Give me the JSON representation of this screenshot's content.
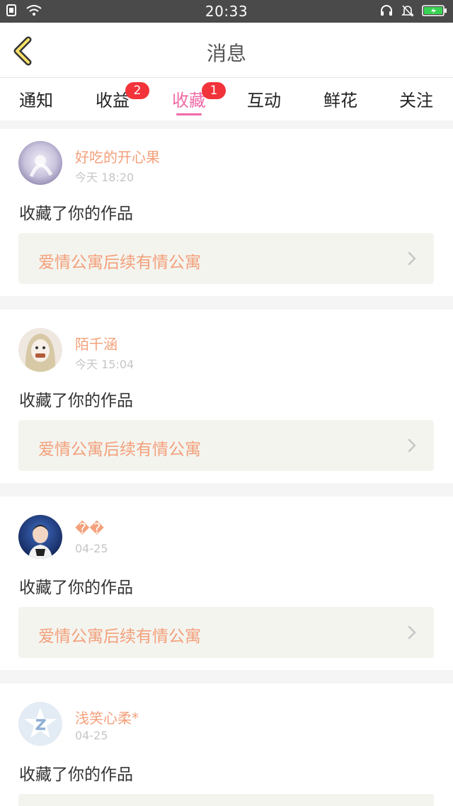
{
  "status_bar": {
    "time": "20:33"
  },
  "header": {
    "title": "消息"
  },
  "tabs": [
    {
      "label": "通知",
      "badge": ""
    },
    {
      "label": "收益",
      "badge": "2"
    },
    {
      "label": "收藏",
      "badge": "1"
    },
    {
      "label": "互动",
      "badge": ""
    },
    {
      "label": "鲜花",
      "badge": ""
    },
    {
      "label": "关注",
      "badge": ""
    }
  ],
  "active_tab": "收藏",
  "colors": {
    "accent": "#f06aa6",
    "name": "#f3a07b",
    "badge": "#f2333a"
  },
  "messages": [
    {
      "user": "好吃的开心果",
      "time": "今天 18:20",
      "action": "收藏了你的作品",
      "work": "爱情公寓后续有情公寓"
    },
    {
      "user": "陌千涵",
      "time": "今天 15:04",
      "action": "收藏了你的作品",
      "work": "爱情公寓后续有情公寓"
    },
    {
      "user": "��",
      "time": "04-25",
      "action": "收藏了你的作品",
      "work": "爱情公寓后续有情公寓"
    },
    {
      "user": "浅笑心柔*",
      "time": "04-25",
      "action": "收藏了你的作品",
      "work": ""
    }
  ]
}
